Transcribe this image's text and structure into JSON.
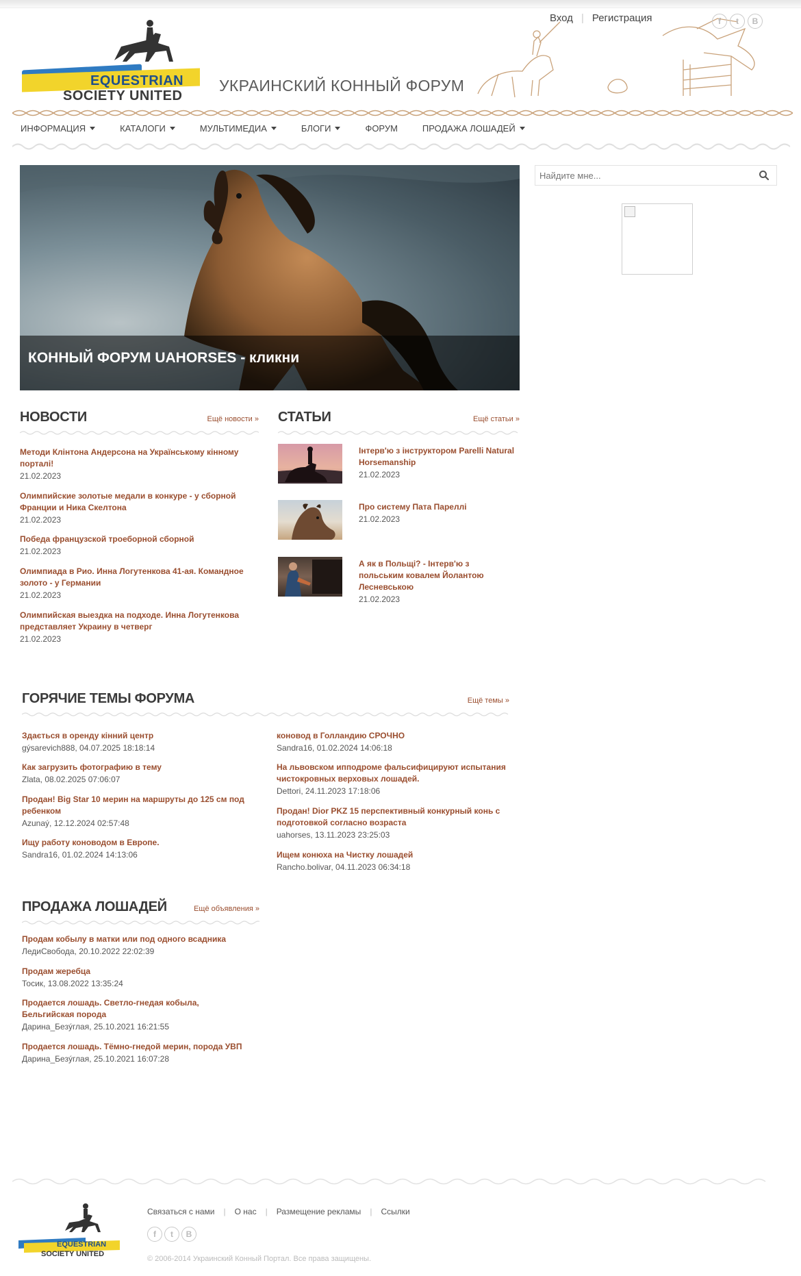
{
  "header": {
    "logo_line1": "EQUESTRIAN",
    "logo_line2": "SOCIETY UNITED",
    "site_title": "УКРАИНСКИЙ КОННЫЙ ФОРУМ",
    "login": "Вход",
    "register": "Регистрация",
    "social": [
      "f",
      "t",
      "B"
    ]
  },
  "nav": {
    "items": [
      "Информация",
      "Каталоги",
      "Мультимедиа",
      "Блоги",
      "Форум",
      "Продажа лошадей"
    ]
  },
  "hero": {
    "caption": "КОННЫЙ ФОРУМ UAHORSES - кликни"
  },
  "search": {
    "placeholder": "Найдите мне..."
  },
  "news": {
    "title": "НОВОСТИ",
    "more": "Ещё новости »",
    "items": [
      {
        "title": "Методи Клінтона Андерсона на Українському кінному порталі!",
        "date": "21.02.2023"
      },
      {
        "title": "Олимпийские золотые медали в конкуре - у сборной Франции и Ника Скелтона",
        "date": "21.02.2023"
      },
      {
        "title": "Победа французской троеборной сборной",
        "date": "21.02.2023"
      },
      {
        "title": "Олимпиада в Рио. Инна Логутенкова 41-ая. Командное золото - у Германии",
        "date": "21.02.2023"
      },
      {
        "title": "Олимпийская выездка на подходе. Инна Логутенкова представляет Украину в четверг",
        "date": "21.02.2023"
      }
    ]
  },
  "articles": {
    "title": "СТАТЬИ",
    "more": "Ещё статьи »",
    "items": [
      {
        "title": "Інтерв'ю з інструктором Parelli Natural Horsemanship",
        "date": "21.02.2023"
      },
      {
        "title": "Про систему Пата Пареллі",
        "date": "21.02.2023"
      },
      {
        "title": "А як в Польщі? - Інтерв'ю з польським ковалем Йолантою Лесневською",
        "date": "21.02.2023"
      }
    ]
  },
  "forum": {
    "title": "ГОРЯЧИЕ ТЕМЫ ФОРУМА",
    "more": "Ещё темы »",
    "left": [
      {
        "title": "Здається в оренду кінний центр",
        "meta": "gýsarevich888, 04.07.2025 18:18:14"
      },
      {
        "title": "Как загрузить фотографию в тему",
        "meta": "Zlata, 08.02.2025 07:06:07"
      },
      {
        "title": "Продан! Big Star 10 мерин на маршруты до 125 см под ребенком",
        "meta": "Azunaý, 12.12.2024 02:57:48"
      },
      {
        "title": "Ищу работу коноводом в Европе.",
        "meta": "Sandra16, 01.02.2024 14:13:06"
      }
    ],
    "right": [
      {
        "title": "коновод в Голландию СРОЧНО",
        "meta": "Sandra16, 01.02.2024 14:06:18"
      },
      {
        "title": "На львовском ипподроме фальсифицируют испытания чистокровных верховых лошадей.",
        "meta": "Dettori, 24.11.2023 17:18:06"
      },
      {
        "title": "Продан! Dior PKZ 15 перспективный конкурный конь с подготовкой согласно возраста",
        "meta": "uahorses, 13.11.2023 23:25:03"
      },
      {
        "title": "Ищем конюха на Чистку лошадей",
        "meta": "Rancho.bolivar, 04.11.2023 06:34:18"
      }
    ]
  },
  "sales": {
    "title": "ПРОДАЖА ЛОШАДЕЙ",
    "more": "Ещё объявления »",
    "items": [
      {
        "title": "Продам кобылу в матки или под одного всадника",
        "meta": "ЛедиСвобода, 20.10.2022 22:02:39"
      },
      {
        "title": "Продам жеребца",
        "meta": "Тосик, 13.08.2022 13:35:24"
      },
      {
        "title": "Продается лошадь. Светло-гнедая кобыла, Бельгийская порода",
        "meta": "Дарина_Безýглая, 25.10.2021 16:21:55"
      },
      {
        "title": "Продается лошадь. Тёмно-гнедой мерин, порода УВП",
        "meta": "Дарина_Безýглая, 25.10.2021 16:07:28"
      }
    ]
  },
  "footer": {
    "links": [
      "Связаться с нами",
      "О нас",
      "Размещение рекламы",
      "Ссылки"
    ],
    "copyright": "© 2006-2014 Украинский Конный Портал. Все права защищены."
  },
  "colors": {
    "link": "#9a4e2f",
    "heading": "#3a3a3a",
    "logo_blue": "#2f7bc2",
    "logo_yellow": "#f2d42b"
  }
}
